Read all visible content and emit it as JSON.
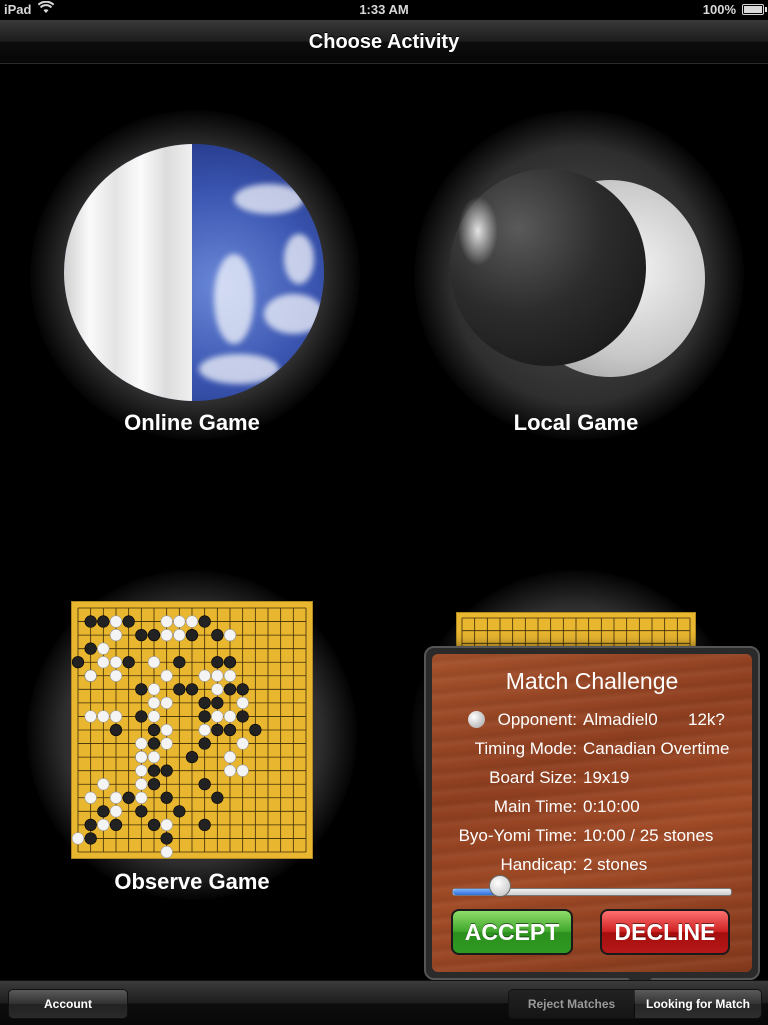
{
  "status_bar": {
    "carrier": "iPad",
    "time": "1:33 AM",
    "battery": "100%"
  },
  "nav": {
    "title": "Choose Activity"
  },
  "activities": {
    "online": "Online Game",
    "local": "Local Game",
    "observe": "Observe Game"
  },
  "observe_board": {
    "size": 19,
    "black": [
      [
        1,
        1
      ],
      [
        2,
        1
      ],
      [
        4,
        1
      ],
      [
        5,
        2
      ],
      [
        6,
        2
      ],
      [
        9,
        2
      ],
      [
        10,
        1
      ],
      [
        11,
        2
      ],
      [
        1,
        3
      ],
      [
        0,
        4
      ],
      [
        4,
        4
      ],
      [
        8,
        4
      ],
      [
        11,
        4
      ],
      [
        12,
        4
      ],
      [
        1,
        5
      ],
      [
        5,
        6
      ],
      [
        8,
        6
      ],
      [
        9,
        6
      ],
      [
        10,
        7
      ],
      [
        11,
        7
      ],
      [
        12,
        6
      ],
      [
        13,
        6
      ],
      [
        5,
        8
      ],
      [
        10,
        8
      ],
      [
        11,
        9
      ],
      [
        12,
        9
      ],
      [
        13,
        8
      ],
      [
        14,
        9
      ],
      [
        3,
        9
      ],
      [
        6,
        9
      ],
      [
        6,
        10
      ],
      [
        10,
        10
      ],
      [
        9,
        11
      ],
      [
        5,
        11
      ],
      [
        6,
        12
      ],
      [
        7,
        12
      ],
      [
        10,
        13
      ],
      [
        11,
        14
      ],
      [
        4,
        14
      ],
      [
        5,
        15
      ],
      [
        6,
        13
      ],
      [
        7,
        14
      ],
      [
        2,
        15
      ],
      [
        3,
        16
      ],
      [
        6,
        16
      ],
      [
        7,
        17
      ],
      [
        8,
        15
      ],
      [
        10,
        16
      ],
      [
        1,
        16
      ],
      [
        1,
        17
      ]
    ],
    "white": [
      [
        3,
        1
      ],
      [
        3,
        2
      ],
      [
        7,
        1
      ],
      [
        8,
        1
      ],
      [
        9,
        1
      ],
      [
        7,
        2
      ],
      [
        8,
        2
      ],
      [
        12,
        2
      ],
      [
        2,
        3
      ],
      [
        3,
        4
      ],
      [
        6,
        4
      ],
      [
        7,
        5
      ],
      [
        2,
        4
      ],
      [
        3,
        5
      ],
      [
        1,
        5
      ],
      [
        6,
        6
      ],
      [
        10,
        5
      ],
      [
        11,
        5
      ],
      [
        11,
        6
      ],
      [
        12,
        5
      ],
      [
        11,
        8
      ],
      [
        12,
        8
      ],
      [
        13,
        7
      ],
      [
        10,
        9
      ],
      [
        1,
        8
      ],
      [
        2,
        8
      ],
      [
        3,
        8
      ],
      [
        6,
        7
      ],
      [
        7,
        7
      ],
      [
        6,
        8
      ],
      [
        7,
        9
      ],
      [
        7,
        10
      ],
      [
        5,
        10
      ],
      [
        5,
        11
      ],
      [
        12,
        11
      ],
      [
        13,
        10
      ],
      [
        5,
        12
      ],
      [
        6,
        11
      ],
      [
        12,
        12
      ],
      [
        2,
        13
      ],
      [
        3,
        14
      ],
      [
        5,
        13
      ],
      [
        5,
        14
      ],
      [
        7,
        16
      ],
      [
        2,
        16
      ],
      [
        3,
        15
      ],
      [
        1,
        14
      ],
      [
        0,
        17
      ],
      [
        7,
        18
      ],
      [
        13,
        12
      ]
    ]
  },
  "local_board_hint": {
    "size": 19
  },
  "challenge": {
    "title": "Match Challenge",
    "rows": [
      {
        "label": "Opponent:",
        "value": "Almadiel0",
        "rank": "12k?"
      },
      {
        "label": "Timing Mode:",
        "value": "Canadian Overtime"
      },
      {
        "label": "Board Size:",
        "value": "19x19"
      },
      {
        "label": "Main Time:",
        "value": "0:10:00"
      },
      {
        "label": "Byo-Yomi Time:",
        "value": "10:00 / 25 stones"
      },
      {
        "label": "Handicap:",
        "value": "2 stones"
      }
    ],
    "slider_value": 0.17,
    "accept_label": "ACCEPT",
    "decline_label": "DECLINE"
  },
  "toolbar": {
    "account_label": "Account",
    "reject_label": "Reject Matches",
    "looking_label": "Looking for Match"
  },
  "colors": {
    "board_wood": "#e9b630",
    "accept": "#3da52a",
    "decline": "#cc2020"
  }
}
